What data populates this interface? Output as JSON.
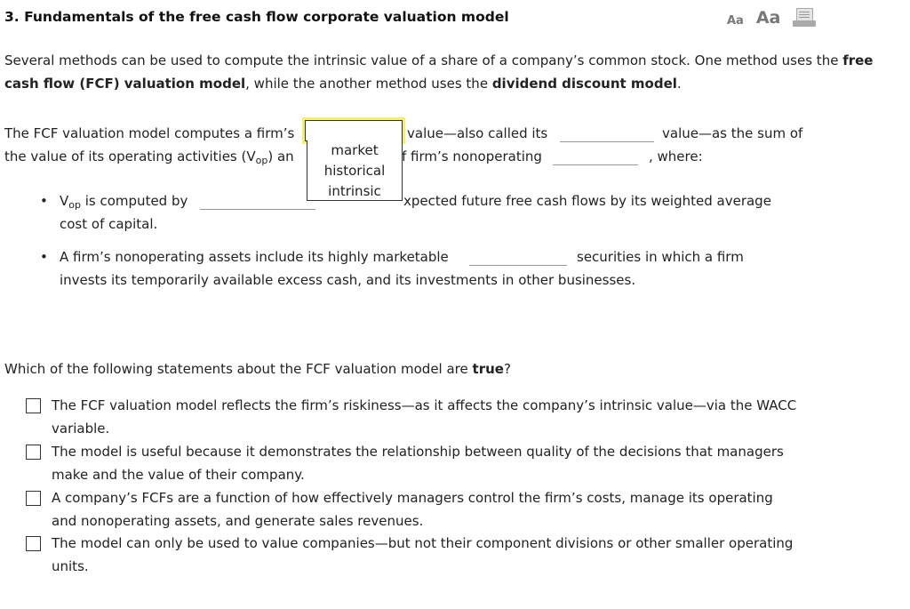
{
  "header": {
    "title": "3.  Fundamentals of the free cash flow corporate valuation model",
    "font_small_label": "Aa",
    "font_large_label": "Aa"
  },
  "intro": {
    "part1": "Several methods can be used to compute the intrinsic value of a share of a company’s common stock. One method uses the ",
    "bold1": "free cash flow (FCF) valuation model",
    "part2": ", while the another method uses the ",
    "bold2": "dividend discount model",
    "part3": "."
  },
  "paragraph": {
    "line1_a": "The FCF valuation model computes a firm’s",
    "line1_b": "value—also called its",
    "line1_c": "value—as the sum of",
    "line2_a": "the value of its operating activities (V",
    "line2_sub": "op",
    "line2_b": ") an",
    "line2_c": "f firm’s nonoperating",
    "line2_d": ", where:"
  },
  "dropdown": {
    "selected": "",
    "options": [
      "market",
      "historical",
      "intrinsic"
    ]
  },
  "bullets": [
    {
      "pre": "V",
      "sub": "op",
      "text_a": " is computed by",
      "text_b": "xpected future free cash flows by its weighted average",
      "line2": "cost of capital."
    },
    {
      "text_a": "A firm’s nonoperating assets include its highly marketable",
      "text_b": "securities in which a firm",
      "line2": "invests its temporarily available excess cash, and its investments in other businesses."
    }
  ],
  "question": {
    "text": "Which of the following statements about the FCF valuation model are ",
    "bold": "true",
    "end": "?"
  },
  "options": [
    {
      "line1": "The FCF valuation model reflects the firm’s riskiness—as it affects the company’s intrinsic value—via the WACC",
      "line2": "variable.",
      "checked": false
    },
    {
      "line1": "The model is useful because it demonstrates the relationship between quality of the decisions that managers",
      "line2": "make and the value of their company.",
      "checked": false
    },
    {
      "line1": "A company’s FCFs are a function of how effectively managers control the firm’s costs, manage its operating",
      "line2": "and nonoperating assets, and generate sales revenues.",
      "checked": false
    },
    {
      "line1": "The model can only be used to value companies—but not their component divisions or other smaller operating",
      "line2": "units.",
      "checked": false
    }
  ]
}
